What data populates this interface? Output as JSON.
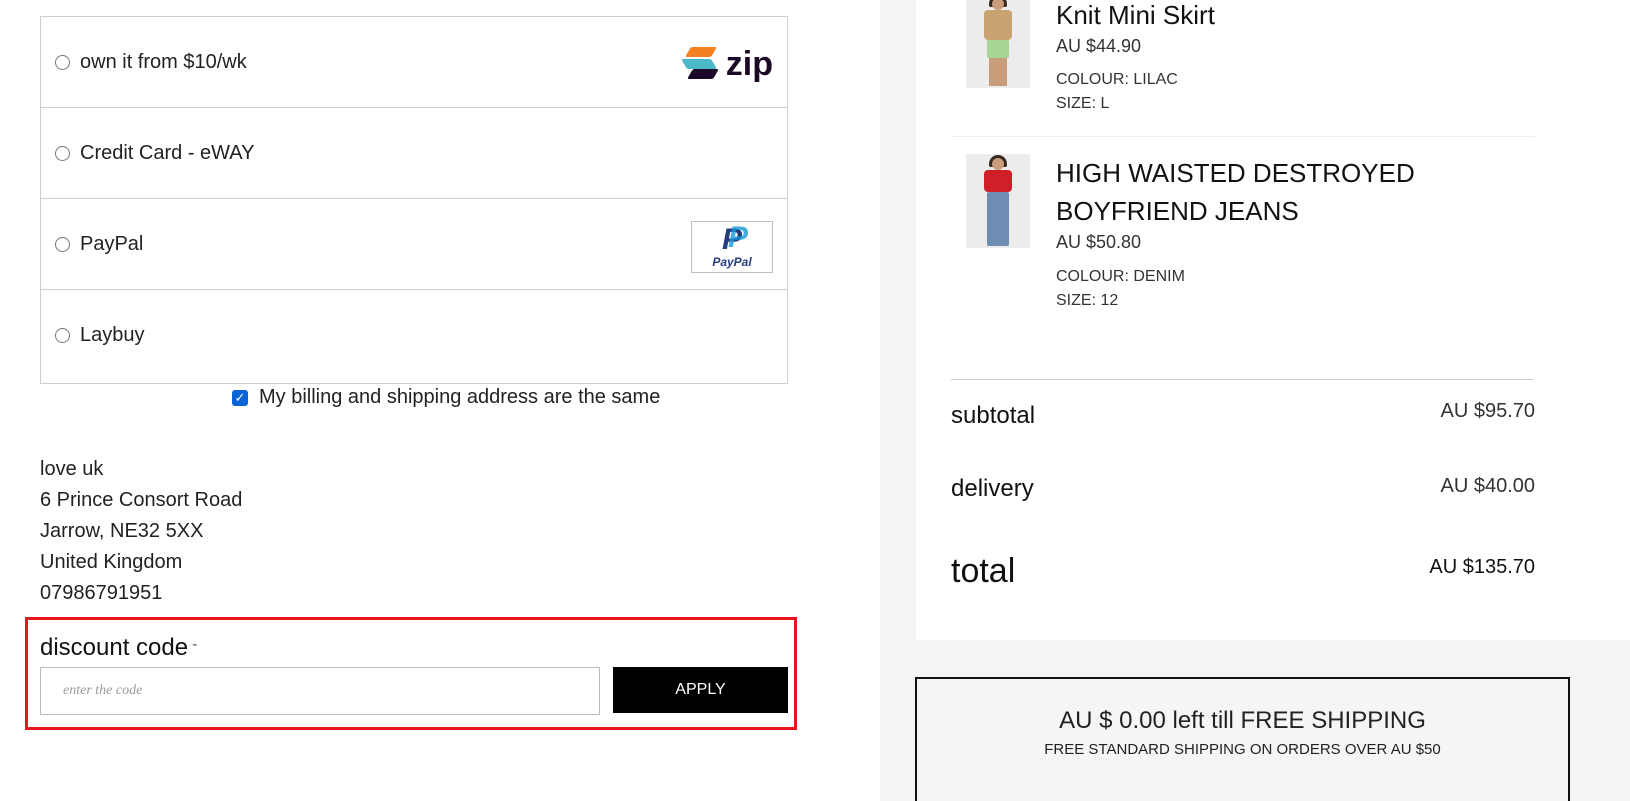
{
  "payment": {
    "options": [
      {
        "label": "own it from $10/wk",
        "logo": "zip"
      },
      {
        "label": "Credit Card - eWAY",
        "logo": ""
      },
      {
        "label": "PayPal",
        "logo": "PayPal"
      },
      {
        "label": "Laybuy",
        "logo": ""
      }
    ],
    "zip_logo_text": "zip",
    "paypal_logo_text": "PayPal",
    "billing_same_label": "My billing and shipping address are the same",
    "billing_same_checked": true
  },
  "address": {
    "name": "love uk",
    "line1": "6 Prince Consort Road",
    "line2": "Jarrow, NE32 5XX",
    "country": "United Kingdom",
    "phone": "07986791951"
  },
  "discount": {
    "title": "discount code",
    "toggle": "-",
    "placeholder": "enter the code",
    "apply_label": "APPLY"
  },
  "cart": {
    "items": [
      {
        "name": "Knit Mini Skirt",
        "price": "AU $44.90",
        "colour": "COLOUR: LILAC",
        "size": "SIZE: L"
      },
      {
        "name_line1": "HIGH WAISTED DESTROYED",
        "name_line2": "BOYFRIEND JEANS",
        "price": "AU $50.80",
        "colour": "COLOUR: DENIM",
        "size": "SIZE: 12"
      }
    ],
    "subtotal_label": "subtotal",
    "subtotal_value": "AU $95.70",
    "delivery_label": "delivery",
    "delivery_value": "AU $40.00",
    "total_label": "total",
    "total_value": "AU $135.70"
  },
  "shipping_banner": {
    "main": "AU $ 0.00 left till FREE SHIPPING",
    "sub": "FREE STANDARD SHIPPING ON ORDERS OVER AU $50"
  },
  "colors": {
    "highlight": "#e8141e",
    "checkbox": "#0b64d8",
    "button": "#000000"
  }
}
